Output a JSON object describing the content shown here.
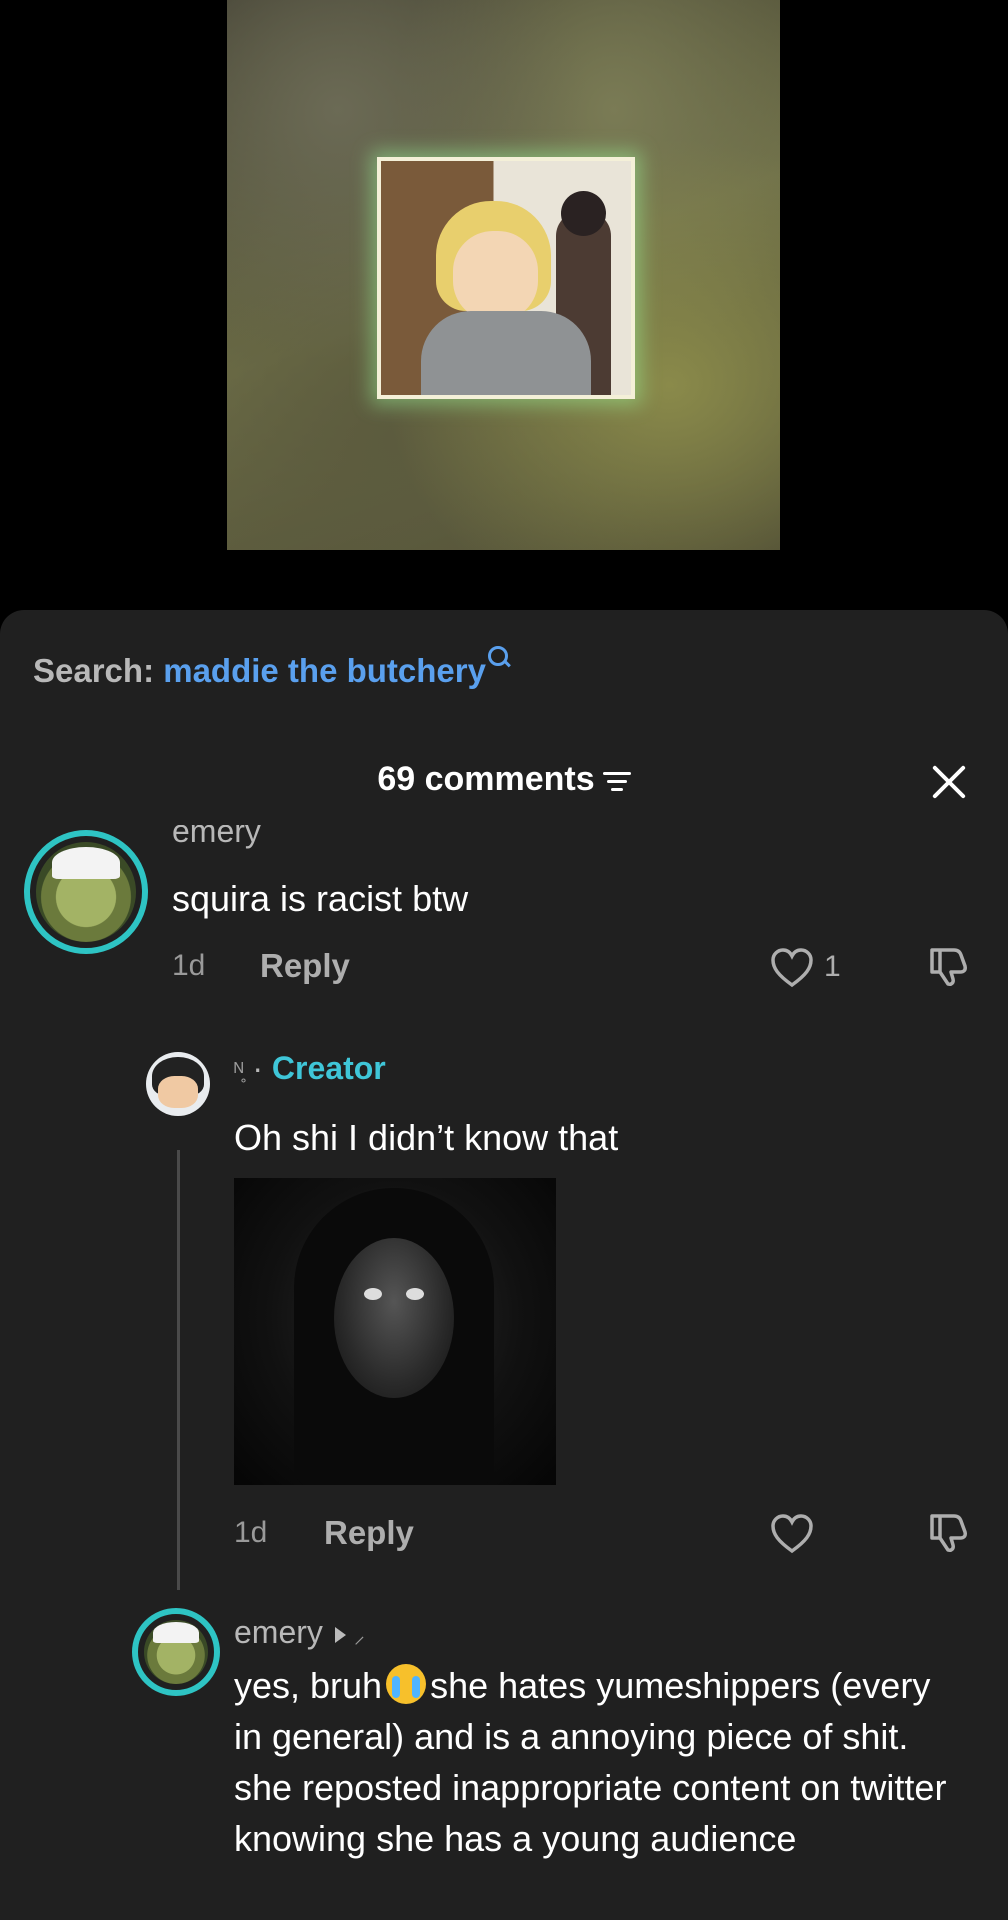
{
  "search": {
    "label": "Search:",
    "term": "maddie the butchery"
  },
  "comments_header": {
    "count_label": "69 comments"
  },
  "comments": [
    {
      "username": "emery",
      "text": "squira is racist btw",
      "age": "1d",
      "reply_label": "Reply",
      "like_count": "1"
    },
    {
      "username_glyphs": "ᴺ̥ ",
      "separator": "·",
      "creator_label": "Creator",
      "text": "Oh shi I didn’t know that",
      "age": "1d",
      "reply_label": "Reply"
    },
    {
      "username": "emery",
      "text_part1": "yes, bruh",
      "text_part2": "she hates yumeshippers (every in general) and is a annoying piece of shit. she reposted inappropriate content on twitter knowing she has a young audience"
    }
  ]
}
